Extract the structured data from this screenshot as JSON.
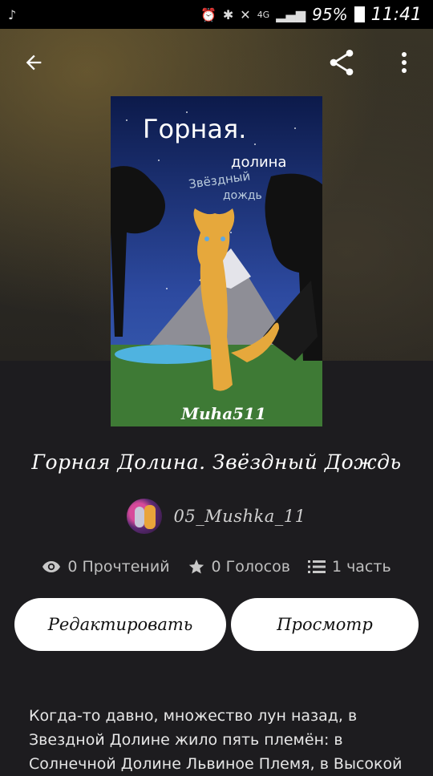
{
  "status_bar": {
    "battery": "95%",
    "time": "11:41",
    "network": "4G"
  },
  "story": {
    "cover_title_line1": "Горная.",
    "cover_title_line2": "долина",
    "cover_subtitle1": "Звёздный",
    "cover_subtitle2": "дождь",
    "cover_signature": "Muha511",
    "title": "Горная Долина. Звёздный Дождь",
    "author": "05_Mushka_11",
    "reads": "0 Прочтений",
    "votes": "0 Голосов",
    "parts": "1 часть",
    "description": "Когда-то давно, множество лун назад, в Звездной Долине жило пять племён: в Солнечной Долине Львиное Племя, в Высокой"
  },
  "buttons": {
    "edit": "Редактировать",
    "preview": "Просмотр"
  },
  "icons": {
    "back": "arrow-left-icon",
    "share": "share-icon",
    "more": "more-vert-icon",
    "eye": "eye-icon",
    "star": "star-icon",
    "list": "list-icon"
  }
}
